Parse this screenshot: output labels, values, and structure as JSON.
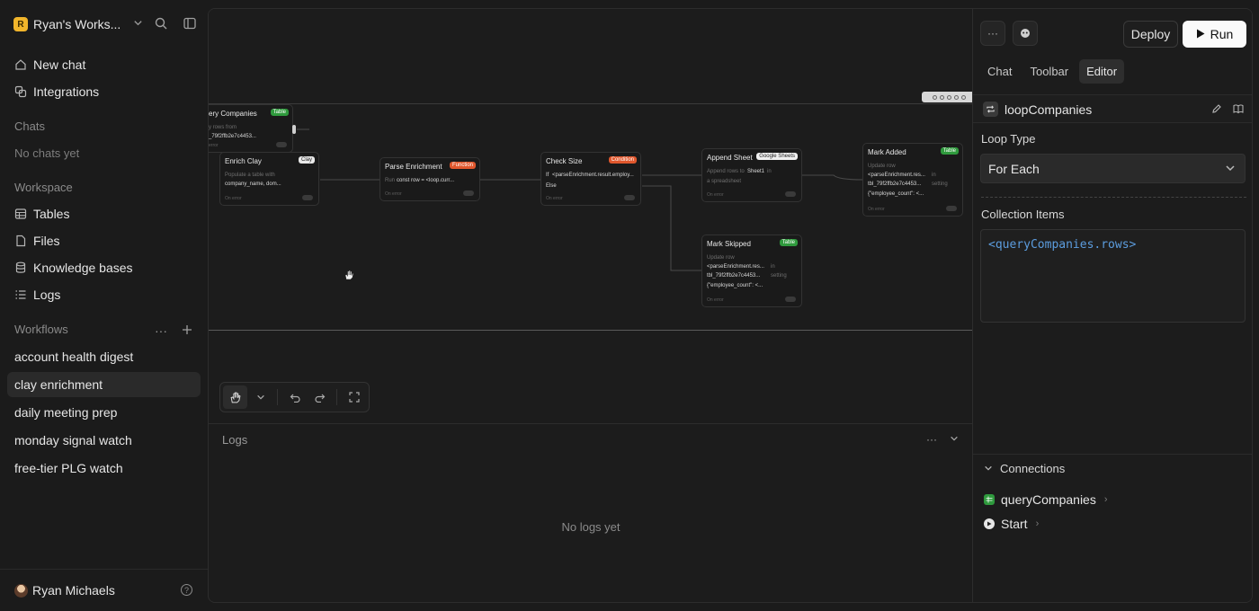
{
  "sidebar": {
    "workspace_logo": "R",
    "workspace_name": "Ryan's Works...",
    "nav": [
      {
        "label": "New chat",
        "icon": "home-icon"
      },
      {
        "label": "Integrations",
        "icon": "integrations-icon"
      }
    ],
    "chats_label": "Chats",
    "chats_empty": "No chats yet",
    "workspace_label": "Workspace",
    "workspace_items": [
      {
        "label": "Tables",
        "icon": "table-icon"
      },
      {
        "label": "Files",
        "icon": "file-icon"
      },
      {
        "label": "Knowledge bases",
        "icon": "database-icon"
      },
      {
        "label": "Logs",
        "icon": "list-icon"
      }
    ],
    "workflows_label": "Workflows",
    "workflows": [
      {
        "label": "account health digest",
        "active": false
      },
      {
        "label": "clay enrichment",
        "active": true
      },
      {
        "label": "daily meeting prep",
        "active": false
      },
      {
        "label": "monday signal watch",
        "active": false
      },
      {
        "label": "free-tier PLG watch",
        "active": false
      }
    ],
    "user_name": "Ryan Michaels",
    "help_glyph": "?"
  },
  "canvas": {
    "nodes": {
      "query": {
        "title": "ery Companies",
        "tag": "Table",
        "l1": "y rows from",
        "l2": "_79f2ffb2e7c4453...",
        "err": "error"
      },
      "enrich": {
        "title": "Enrich Clay",
        "tag": "Clay",
        "l1": "Populate a table with",
        "l2": "company_name, dom...",
        "err": "On error"
      },
      "parse": {
        "title": "Parse Enrichment",
        "tag": "Function",
        "l1": "Run",
        "l2": "const row = <loop.curr...",
        "err": "On error"
      },
      "check": {
        "title": "Check Size",
        "tag": "Condition",
        "l1": "If",
        "l2": "<parseEnrichment.result.employ...",
        "l3": "Else",
        "err": "On error"
      },
      "append": {
        "title": "Append Sheet",
        "tag": "Google Sheets",
        "l1": "Append rows to",
        "l2": "Sheet1",
        "l2b": "in",
        "l3": "a spreadsheet",
        "err": "On error"
      },
      "added": {
        "title": "Mark Added",
        "tag": "Table",
        "l1": "Update row",
        "l2": "<parseEnrichment.res...",
        "l2b": "in",
        "l3": "tbl_79f2ffb2e7c4453...",
        "l3b": "setting",
        "l4": "{\"employee_count\": <...",
        "err": "On error"
      },
      "skipped": {
        "title": "Mark Skipped",
        "tag": "Table",
        "l1": "Update row",
        "l2": "<parseEnrichment.res...",
        "l2b": "in",
        "l3": "tbl_79f2ffb2e7c4453...",
        "l3b": "setting",
        "l4": "{\"employee_count\": <...",
        "err": "On error"
      }
    }
  },
  "logs": {
    "title": "Logs",
    "empty": "No logs yet"
  },
  "right_panel": {
    "deploy_label": "Deploy",
    "run_label": "Run",
    "tabs": [
      {
        "label": "Chat",
        "active": false
      },
      {
        "label": "Toolbar",
        "active": false
      },
      {
        "label": "Editor",
        "active": true
      }
    ],
    "block_name": "loopCompanies",
    "loop_type_label": "Loop Type",
    "loop_type_value": "For Each",
    "collection_label": "Collection Items",
    "collection_value": "<queryCompanies.rows>",
    "connections_label": "Connections",
    "connections": [
      {
        "label": "queryCompanies",
        "icon": "table-icon"
      },
      {
        "label": "Start",
        "icon": "start-icon"
      }
    ]
  }
}
